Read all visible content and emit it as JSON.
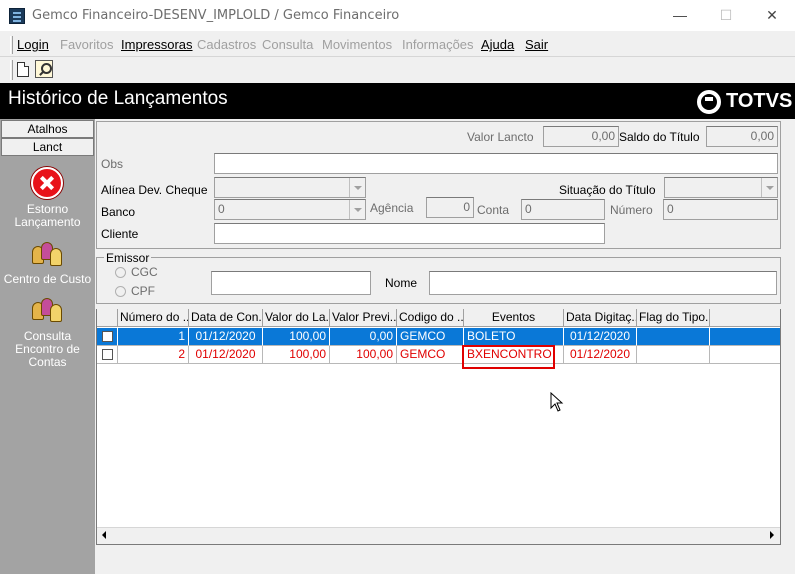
{
  "window": {
    "title": "Gemco Financeiro-DESENV_IMPLOLD / Gemco Financeiro",
    "min_glyph": "—",
    "max_glyph": "☐",
    "close_glyph": "✕"
  },
  "menu": [
    {
      "label": "Login",
      "enabled": true
    },
    {
      "label": "Favoritos",
      "enabled": false
    },
    {
      "label": "Impressoras",
      "enabled": true
    },
    {
      "label": "Cadastros",
      "enabled": false
    },
    {
      "label": "Consulta",
      "enabled": false
    },
    {
      "label": "Movimentos",
      "enabled": false
    },
    {
      "label": "Informações",
      "enabled": false
    },
    {
      "label": "Ajuda",
      "enabled": true
    },
    {
      "label": "Sair",
      "enabled": true
    }
  ],
  "toolbar": {
    "icons": [
      "new-document-icon",
      "search-document-icon"
    ]
  },
  "header": {
    "title": "Histórico de Lançamentos",
    "brand": "TOTVS"
  },
  "sidebar": {
    "tabs": [
      "Atalhos",
      "Lanct"
    ],
    "actions": [
      {
        "lines": [
          "Estorno",
          "Lançamento"
        ],
        "icon": "cancel-icon"
      },
      {
        "lines": [
          "Centro de Custo"
        ],
        "icon": "people-icon"
      },
      {
        "lines": [
          "Consulta",
          "Encontro de",
          "Contas"
        ],
        "icon": "people-icon"
      }
    ]
  },
  "form": {
    "valor_lancto_label": "Valor Lancto",
    "valor_lancto_value": "0,00",
    "saldo_titulo_label": "Saldo do Título",
    "saldo_titulo_value": "0,00",
    "obs_label": "Obs",
    "obs_value": "",
    "alinea_label": "Alínea Dev. Cheque",
    "alinea_value": "",
    "situacao_label": "Situação do Título",
    "situacao_value": "",
    "banco_label": "Banco",
    "banco_value": "0",
    "agencia_label": "Agência",
    "agencia_value": "0",
    "conta_label": "Conta",
    "conta_value": "0",
    "numero_label": "Número",
    "numero_value": "0",
    "cliente_label": "Cliente",
    "cliente_value": ""
  },
  "emissor": {
    "legend": "Emissor",
    "radio_cgc": "CGC",
    "radio_cpf": "CPF",
    "doc_value": "",
    "nome_label": "Nome",
    "nome_value": ""
  },
  "grid": {
    "columns": [
      "Número do ...",
      "Data de Con...",
      "Valor do La...",
      "Valor Previ...",
      "Codigo do ...",
      "Eventos",
      "Data Digitaç...",
      "Flag do Tipo..."
    ],
    "rows": [
      {
        "numero": "1",
        "data_con": "01/12/2020",
        "valor": "100,00",
        "valor_prev": "0,00",
        "codigo": "GEMCO",
        "eventos": "BOLETO",
        "data_dig": "01/12/2020",
        "flag": ""
      },
      {
        "numero": "2",
        "data_con": "01/12/2020",
        "valor": "100,00",
        "valor_prev": "100,00",
        "codigo": "GEMCO",
        "eventos": "BXENCONTRO",
        "data_dig": "01/12/2020",
        "flag": ""
      }
    ]
  },
  "colors": {
    "selected_row": "#0a78d7",
    "red_text": "#e00000",
    "header_bg": "#000000",
    "sidebar_bg": "#a3a3a3"
  }
}
